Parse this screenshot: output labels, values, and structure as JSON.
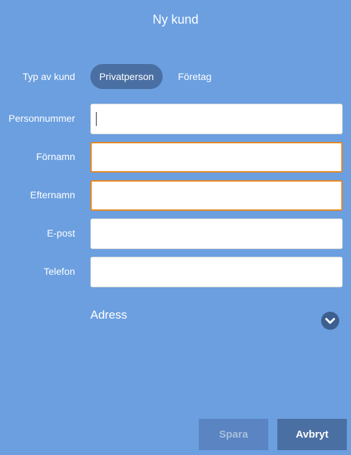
{
  "dialog": {
    "title": "Ny kund"
  },
  "customer_type": {
    "label": "Typ av kund",
    "options": [
      "Privatperson",
      "Företag"
    ],
    "selected": "Privatperson"
  },
  "fields": {
    "personnummer": {
      "label": "Personnummer",
      "value": "",
      "state": "focused"
    },
    "fornamn": {
      "label": "Förnamn",
      "value": "",
      "state": "error"
    },
    "efternamn": {
      "label": "Efternamn",
      "value": "",
      "state": "error"
    },
    "epost": {
      "label": "E-post",
      "value": "",
      "state": "normal"
    },
    "telefon": {
      "label": "Telefon",
      "value": "",
      "state": "normal"
    }
  },
  "address": {
    "label": "Adress",
    "icon": "chevron-down-icon"
  },
  "actions": {
    "save_label": "Spara",
    "save_disabled": true,
    "cancel_label": "Avbryt"
  },
  "colors": {
    "background": "#6b9fe0",
    "active_segment": "#4a6fa3",
    "error_border": "#e8871e",
    "save_button": "#5a84c2",
    "cancel_button": "#4a6fa3"
  }
}
